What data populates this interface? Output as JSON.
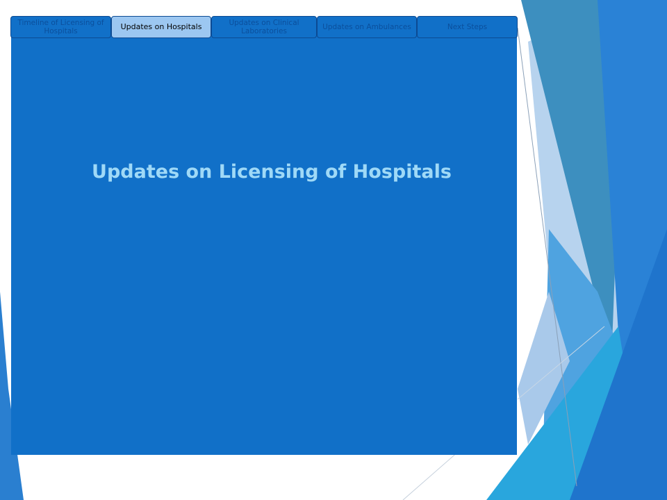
{
  "tabs": [
    {
      "label": "Timeline of Licensing of Hospitals",
      "active": false
    },
    {
      "label": "Updates on Hospitals",
      "active": true
    },
    {
      "label": "Updates on Clinical Laboratories",
      "active": false
    },
    {
      "label": "Updates on Ambulances",
      "active": false
    },
    {
      "label": "Next Steps",
      "active": false
    }
  ],
  "slide": {
    "title": "Updates on Licensing of Hospitals"
  },
  "colors": {
    "panel": "#1170c8",
    "title": "#9fd9f7",
    "active_tab": "#9cc7f1",
    "tab_border": "#0c4a92"
  }
}
